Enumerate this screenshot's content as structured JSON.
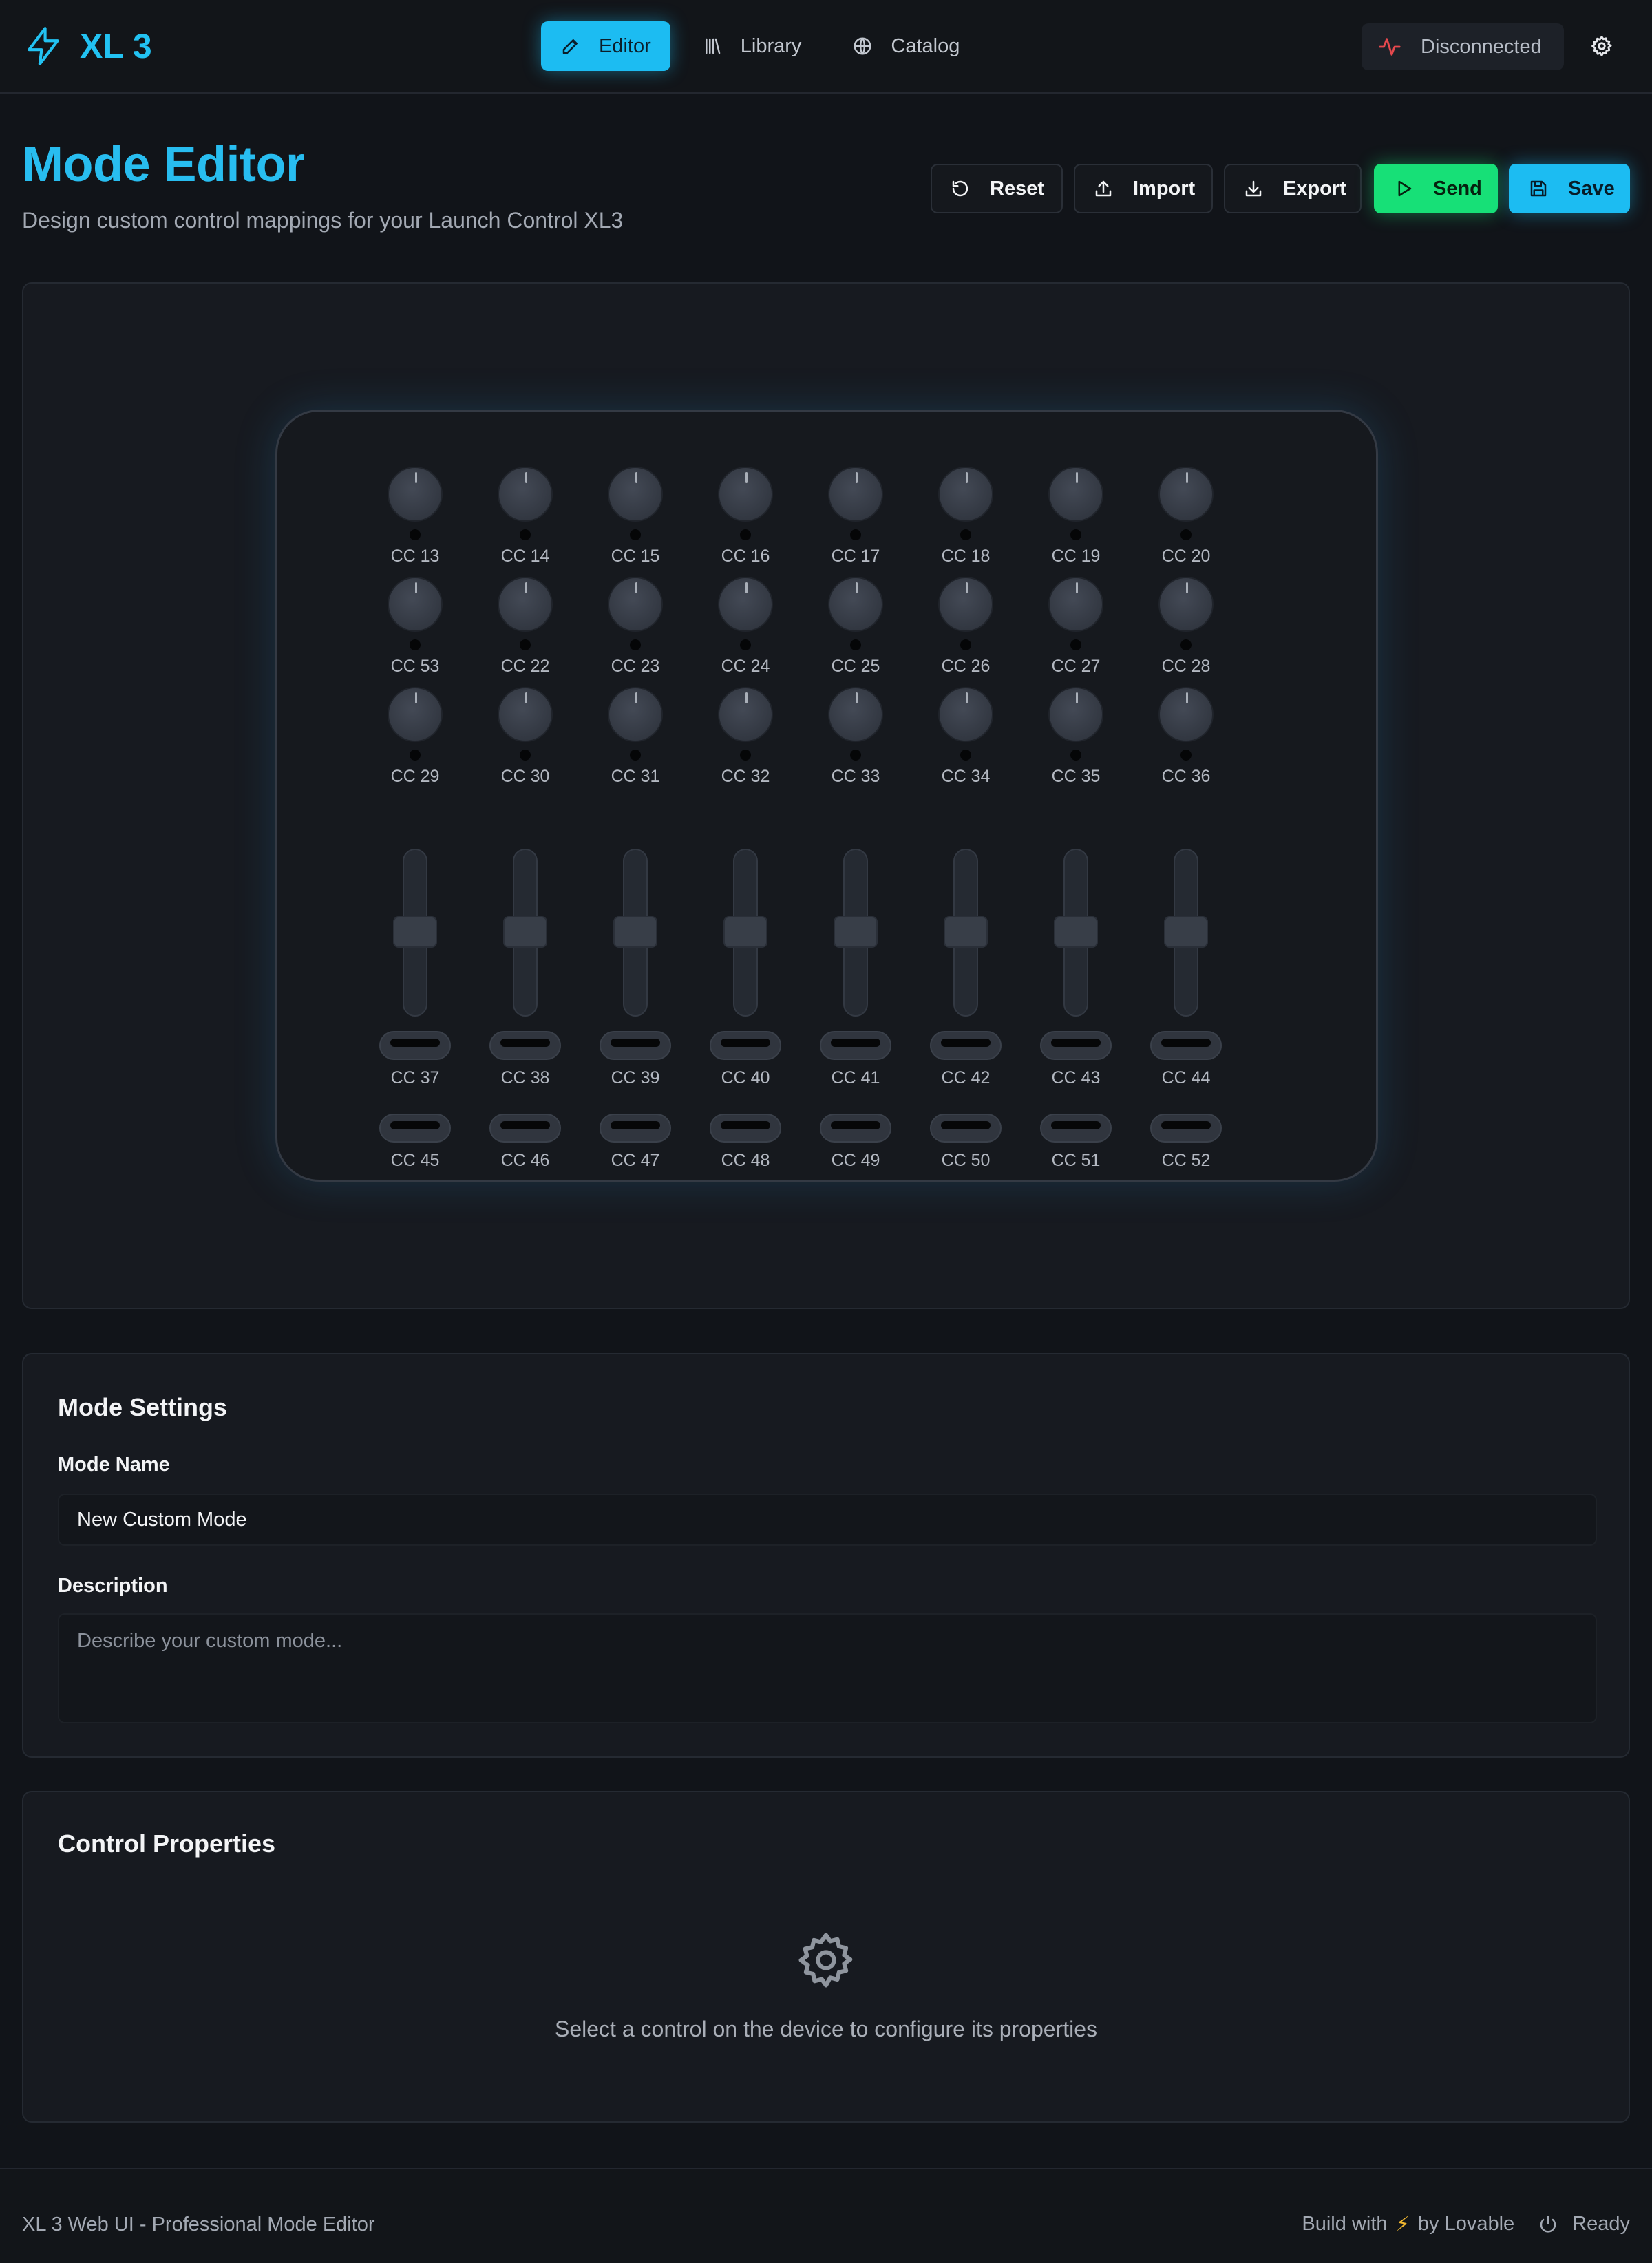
{
  "app": {
    "name": "XL 3",
    "accent_color": "#22c2f2"
  },
  "nav": {
    "tabs": [
      {
        "label": "Editor",
        "icon": "pencil-icon",
        "active": true
      },
      {
        "label": "Library",
        "icon": "library-icon",
        "active": false
      },
      {
        "label": "Catalog",
        "icon": "globe-icon",
        "active": false
      }
    ]
  },
  "status": {
    "label": "Disconnected",
    "icon": "activity-icon",
    "color": "#e5484d"
  },
  "page": {
    "title": "Mode Editor",
    "subtitle": "Design custom control mappings for your Launch Control XL3"
  },
  "toolbar": {
    "reset_label": "Reset",
    "import_label": "Import",
    "export_label": "Export",
    "send_label": "Send",
    "save_label": "Save",
    "send_color": "#17e077",
    "save_color": "#1cbcf2"
  },
  "device": {
    "knob_rows": [
      [
        "CC 13",
        "CC 14",
        "CC 15",
        "CC 16",
        "CC 17",
        "CC 18",
        "CC 19",
        "CC 20"
      ],
      [
        "CC 53",
        "CC 22",
        "CC 23",
        "CC 24",
        "CC 25",
        "CC 26",
        "CC 27",
        "CC 28"
      ],
      [
        "CC 29",
        "CC 30",
        "CC 31",
        "CC 32",
        "CC 33",
        "CC 34",
        "CC 35",
        "CC 36"
      ]
    ],
    "button_rows": [
      [
        "CC 37",
        "CC 38",
        "CC 39",
        "CC 40",
        "CC 41",
        "CC 42",
        "CC 43",
        "CC 44"
      ],
      [
        "CC 45",
        "CC 46",
        "CC 47",
        "CC 48",
        "CC 49",
        "CC 50",
        "CC 51",
        "CC 52"
      ]
    ],
    "fader_count": 8
  },
  "mode_settings": {
    "title": "Mode Settings",
    "name_label": "Mode Name",
    "name_value": "New Custom Mode",
    "description_label": "Description",
    "description_placeholder": "Describe your custom mode..."
  },
  "control_properties": {
    "title": "Control Properties",
    "empty_message": "Select a control on the device to configure its properties",
    "empty_icon": "gear-icon"
  },
  "footer": {
    "left_text": "XL 3 Web UI - Professional Mode Editor",
    "build_prefix": "Build with",
    "build_bolt": "⚡",
    "build_suffix": "by Lovable",
    "ready_label": "Ready"
  }
}
